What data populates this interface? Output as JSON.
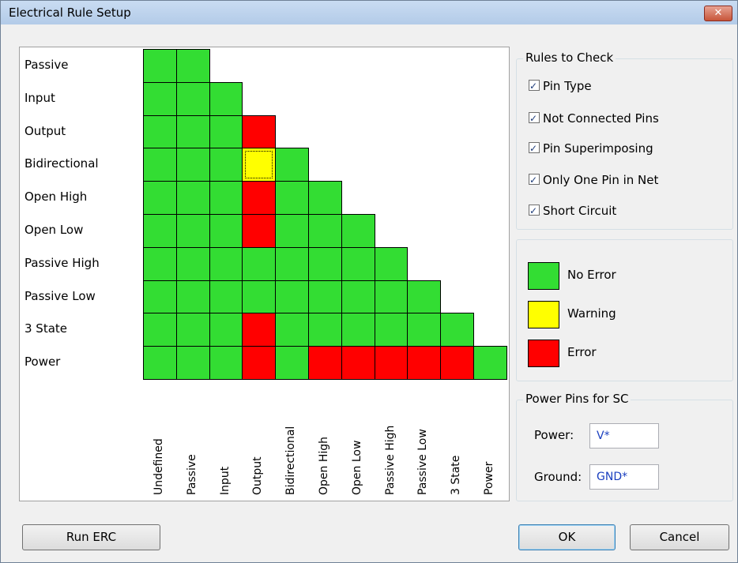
{
  "window": {
    "title": "Electrical Rule Setup",
    "close_label": "✕"
  },
  "matrix": {
    "rows": [
      "Passive",
      "Input",
      "Output",
      "Bidirectional",
      "Open High",
      "Open Low",
      "Passive High",
      "Passive Low",
      "3 State",
      "Power"
    ],
    "columns": [
      "Undefined",
      "Passive",
      "Input",
      "Output",
      "Bidirectional",
      "Open High",
      "Open Low",
      "Passive High",
      "Passive Low",
      "3 State",
      "Power"
    ],
    "cells": [
      [
        "green",
        "green"
      ],
      [
        "green",
        "green",
        "green"
      ],
      [
        "green",
        "green",
        "green",
        "red"
      ],
      [
        "green",
        "green",
        "green",
        "yellow",
        "green"
      ],
      [
        "green",
        "green",
        "green",
        "red",
        "green",
        "green"
      ],
      [
        "green",
        "green",
        "green",
        "red",
        "green",
        "green",
        "green"
      ],
      [
        "green",
        "green",
        "green",
        "green",
        "green",
        "green",
        "green",
        "green"
      ],
      [
        "green",
        "green",
        "green",
        "green",
        "green",
        "green",
        "green",
        "green",
        "green"
      ],
      [
        "green",
        "green",
        "green",
        "red",
        "green",
        "green",
        "green",
        "green",
        "green",
        "green"
      ],
      [
        "green",
        "green",
        "green",
        "red",
        "green",
        "red",
        "red",
        "red",
        "red",
        "red",
        "green"
      ]
    ],
    "selected_cell": [
      3,
      3
    ]
  },
  "rules": {
    "title": "Rules to Check",
    "items": [
      {
        "label": "Pin Type",
        "checked": true
      },
      {
        "label": "Not Connected Pins",
        "checked": true
      },
      {
        "label": "Pin Superimposing",
        "checked": true
      },
      {
        "label": "Only One Pin in Net",
        "checked": true
      },
      {
        "label": "Short Circuit",
        "checked": true
      }
    ]
  },
  "legend": {
    "items": [
      {
        "label": "No Error",
        "color": "#33dd33"
      },
      {
        "label": "Warning",
        "color": "#ffff00"
      },
      {
        "label": "Error",
        "color": "#ff0000"
      }
    ]
  },
  "power_pins": {
    "title": "Power Pins for SC",
    "power_label": "Power:",
    "power_value": "V*",
    "ground_label": "Ground:",
    "ground_value": "GND*"
  },
  "buttons": {
    "run_erc": "Run ERC",
    "ok": "OK",
    "cancel": "Cancel"
  }
}
